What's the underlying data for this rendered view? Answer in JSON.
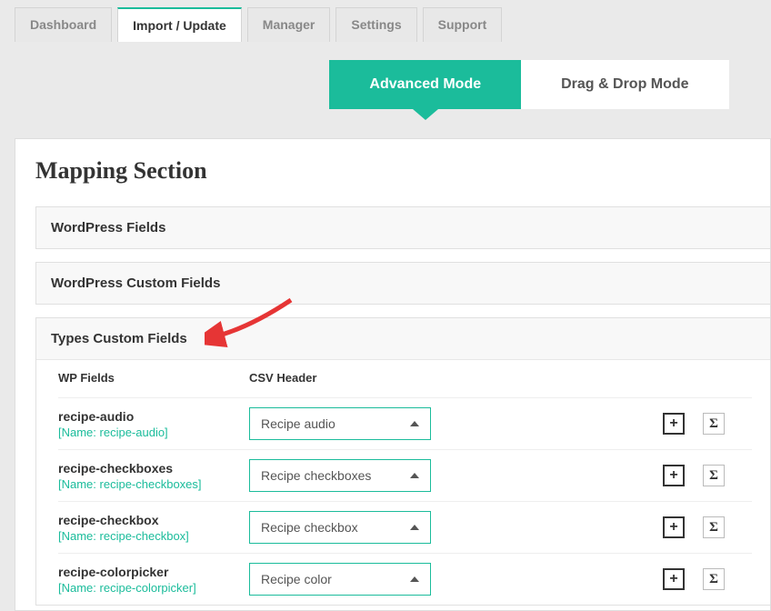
{
  "tabs": [
    {
      "label": "Dashboard",
      "active": false
    },
    {
      "label": "Import / Update",
      "active": true
    },
    {
      "label": "Manager",
      "active": false
    },
    {
      "label": "Settings",
      "active": false
    },
    {
      "label": "Support",
      "active": false
    }
  ],
  "modes": {
    "advanced": "Advanced Mode",
    "dragdrop": "Drag & Drop Mode"
  },
  "section_title": "Mapping Section",
  "accordions": [
    {
      "title": "WordPress Fields",
      "open": false
    },
    {
      "title": "WordPress Custom Fields",
      "open": false
    },
    {
      "title": "Types Custom Fields",
      "open": true
    }
  ],
  "columns": {
    "wp": "WP Fields",
    "csv": "CSV Header"
  },
  "fields": [
    {
      "name": "recipe-audio",
      "sub": "[Name: recipe-audio]",
      "csv": "Recipe audio"
    },
    {
      "name": "recipe-checkboxes",
      "sub": "[Name: recipe-checkboxes]",
      "csv": "Recipe checkboxes"
    },
    {
      "name": "recipe-checkbox",
      "sub": "[Name: recipe-checkbox]",
      "csv": "Recipe checkbox"
    },
    {
      "name": "recipe-colorpicker",
      "sub": "[Name: recipe-colorpicker]",
      "csv": "Recipe color"
    }
  ],
  "icons": {
    "plus": "+",
    "sigma": "Σ"
  }
}
